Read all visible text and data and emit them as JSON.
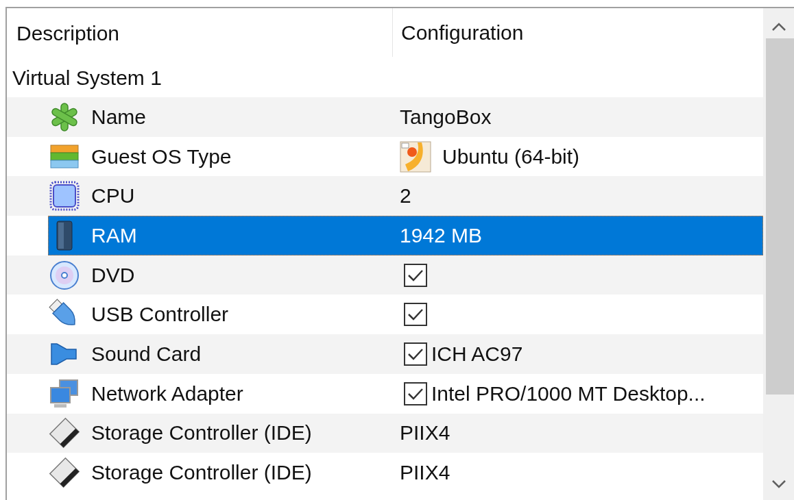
{
  "table": {
    "columns": [
      "Description",
      "Configuration"
    ],
    "group": "Virtual System 1",
    "rows": [
      {
        "description": "Name",
        "selected": false,
        "config": {
          "kind": "text",
          "value": "TangoBox"
        }
      },
      {
        "description": "Guest OS Type",
        "selected": false,
        "config": {
          "kind": "os",
          "value": "Ubuntu (64-bit)"
        }
      },
      {
        "description": "CPU",
        "selected": false,
        "config": {
          "kind": "text",
          "value": "2"
        }
      },
      {
        "description": "RAM",
        "selected": true,
        "config": {
          "kind": "text",
          "value": "1942 MB"
        }
      },
      {
        "description": "DVD",
        "selected": false,
        "config": {
          "kind": "checkbox",
          "checked": true
        }
      },
      {
        "description": "USB Controller",
        "selected": false,
        "config": {
          "kind": "checkbox",
          "checked": true
        }
      },
      {
        "description": "Sound Card",
        "selected": false,
        "config": {
          "kind": "checkbox",
          "checked": true,
          "value": "ICH AC97"
        }
      },
      {
        "description": "Network Adapter",
        "selected": false,
        "config": {
          "kind": "checkbox",
          "checked": true,
          "value": "Intel PRO/1000 MT Desktop..."
        }
      },
      {
        "description": "Storage Controller (IDE)",
        "selected": false,
        "config": {
          "kind": "text",
          "value": "PIIX4"
        }
      },
      {
        "description": "Storage Controller (IDE)",
        "selected": false,
        "config": {
          "kind": "text",
          "value": "PIIX4"
        }
      }
    ]
  }
}
